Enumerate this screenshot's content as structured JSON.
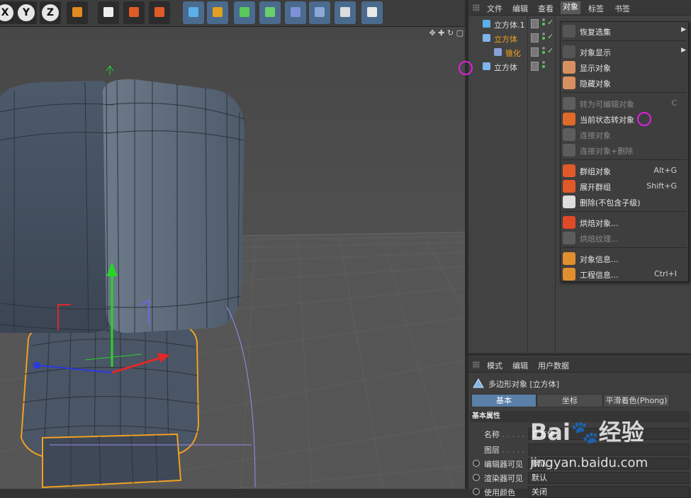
{
  "toolbar": {
    "axis_buttons": [
      "X",
      "Y",
      "Z"
    ],
    "icons": [
      "coordinate-system-icon",
      "render-view-icon",
      "render-picture-icon",
      "render-settings-icon",
      "cube-icon",
      "pen-icon",
      "subdivision-icon",
      "mograph-cloner-icon",
      "deformer-icon",
      "floor-icon",
      "camera-icon",
      "light-icon"
    ]
  },
  "viewport": {
    "nav_icons": "✥ ✚ ↻ ▢"
  },
  "object_manager": {
    "menu": [
      "文件",
      "编辑",
      "查看",
      "对象",
      "标签",
      "书签"
    ],
    "active_menu": "对象",
    "tree": [
      {
        "label": "立方体.1",
        "color": "#dddddd",
        "indent": 0
      },
      {
        "label": "立方体",
        "color": "#f0a020",
        "indent": 0
      },
      {
        "label": "锥化",
        "color": "#f0a020",
        "indent": 1
      },
      {
        "label": "立方体",
        "color": "#dddddd",
        "indent": 0
      }
    ]
  },
  "context_menu": {
    "items": [
      {
        "label": "恢复选集",
        "shortcut": "",
        "arrow": "▶",
        "disabled": false,
        "icon": "blank-icon"
      },
      {
        "label": "对象显示",
        "shortcut": "",
        "arrow": "▶",
        "disabled": false,
        "icon": "blank-icon"
      },
      {
        "label": "显示对象",
        "shortcut": "",
        "arrow": "",
        "disabled": false,
        "icon": "show-object-icon"
      },
      {
        "label": "隐藏对象",
        "shortcut": "",
        "arrow": "",
        "disabled": false,
        "icon": "hide-object-icon"
      },
      {
        "label": "转为可编辑对象",
        "shortcut": "C",
        "arrow": "",
        "disabled": true,
        "icon": "make-editable-icon"
      },
      {
        "label": "当前状态转对象",
        "shortcut": "",
        "arrow": "",
        "disabled": false,
        "icon": "current-state-icon"
      },
      {
        "label": "连接对象",
        "shortcut": "",
        "arrow": "",
        "disabled": true,
        "icon": "connect-object-icon"
      },
      {
        "label": "连接对象+删除",
        "shortcut": "",
        "arrow": "",
        "disabled": true,
        "icon": "connect-delete-icon"
      },
      {
        "label": "群组对象",
        "shortcut": "Alt+G",
        "arrow": "",
        "disabled": false,
        "icon": "group-object-icon"
      },
      {
        "label": "展开群组",
        "shortcut": "Shift+G",
        "arrow": "",
        "disabled": false,
        "icon": "expand-group-icon"
      },
      {
        "label": "删除(不包含子级)",
        "shortcut": "",
        "arrow": "",
        "disabled": false,
        "icon": "delete-no-children-icon"
      },
      {
        "label": "烘焙对象...",
        "shortcut": "",
        "arrow": "",
        "disabled": false,
        "icon": "bake-object-icon"
      },
      {
        "label": "烘焙纹理...",
        "shortcut": "",
        "arrow": "",
        "disabled": true,
        "icon": "bake-texture-icon"
      },
      {
        "label": "对象信息...",
        "shortcut": "",
        "arrow": "",
        "disabled": false,
        "icon": "object-info-icon"
      },
      {
        "label": "工程信息...",
        "shortcut": "Ctrl+I",
        "arrow": "",
        "disabled": false,
        "icon": "project-info-icon"
      }
    ]
  },
  "attributes": {
    "menu": [
      "模式",
      "编辑",
      "用户数据"
    ],
    "title": "多边形对象 [立方体]",
    "tabs": [
      "基本",
      "坐标",
      "平滑着色(Phong)"
    ],
    "active_tab": "基本",
    "section": "基本属性",
    "fields": [
      {
        "label": "名称",
        "dots": " . . . . . .",
        "value": "立方体",
        "radio": false
      },
      {
        "label": "图层",
        "dots": " . . . . . .",
        "value": "",
        "radio": false
      },
      {
        "label": "编辑器可见",
        "dots": "",
        "value": "默认",
        "radio": true
      },
      {
        "label": "渲染器可见",
        "dots": "",
        "value": "默认",
        "radio": true
      },
      {
        "label": "使用颜色",
        "dots": "",
        "value": "关闭",
        "radio": true
      }
    ]
  },
  "watermark": {
    "logo": "Bai🐾经验",
    "url": "jingyan.baidu.com"
  }
}
